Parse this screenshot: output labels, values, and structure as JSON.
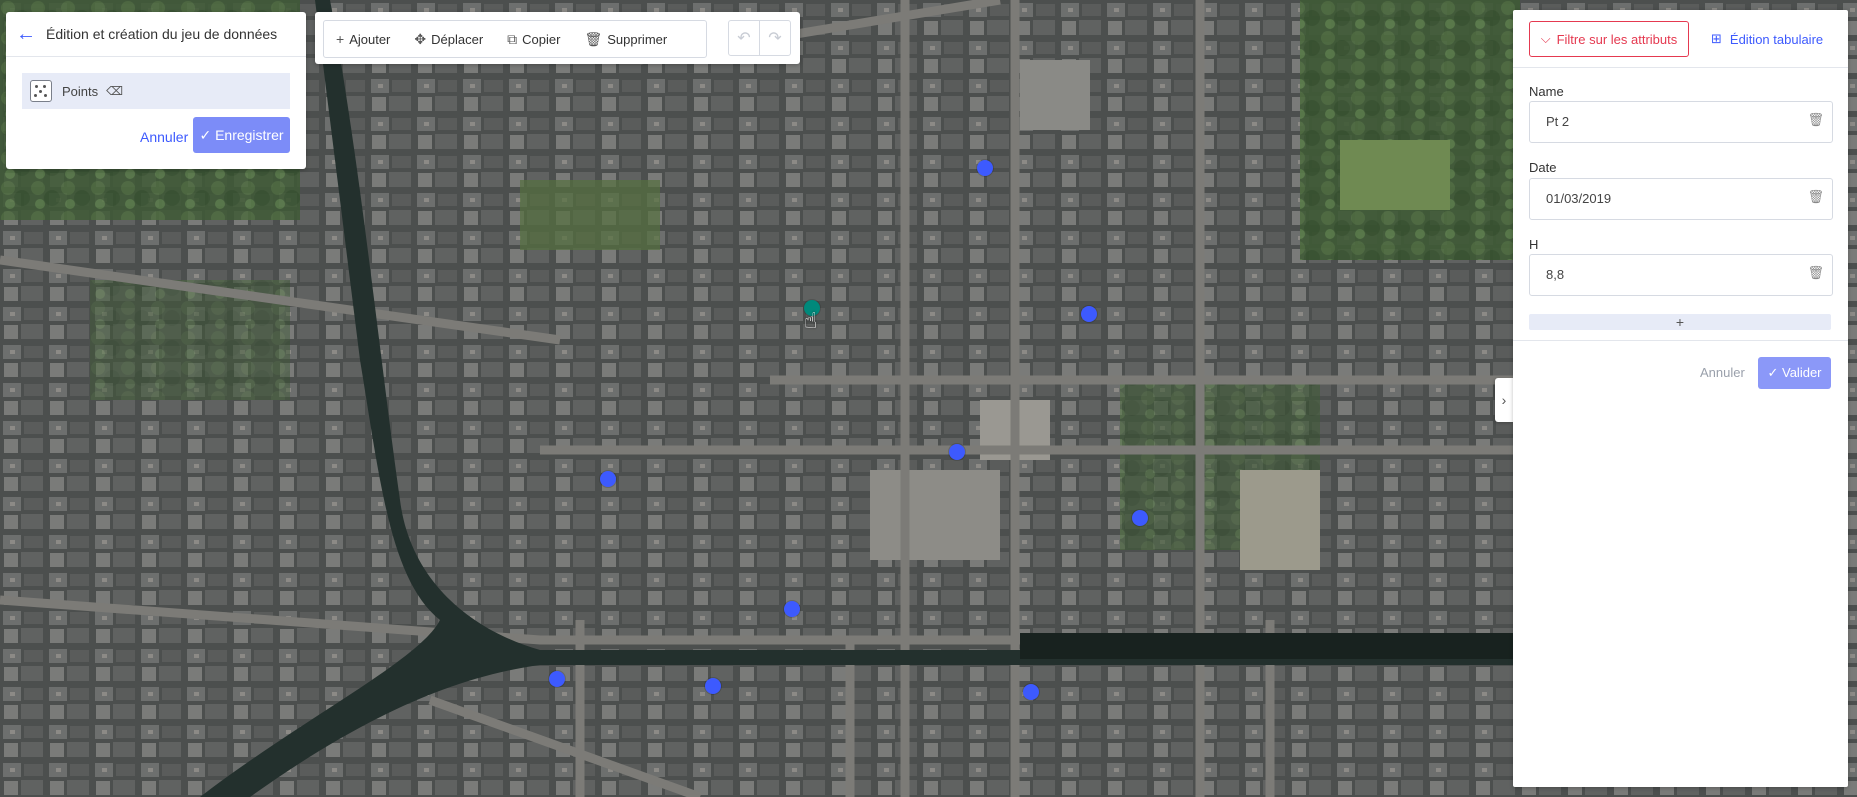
{
  "dataset_panel": {
    "title": "Édition et création du jeu de données",
    "layer_name": "Points",
    "cancel_label": "Annuler",
    "save_label": "Enregistrer"
  },
  "toolbar": {
    "add_label": "Ajouter",
    "move_label": "Déplacer",
    "copy_label": "Copier",
    "delete_label": "Supprimer"
  },
  "attribute_panel": {
    "filter_label": "Filtre sur les attributs",
    "tabular_label": "Édition tabulaire",
    "fields": [
      {
        "label": "Name",
        "value": "Pt 2"
      },
      {
        "label": "Date",
        "value": "01/03/2019"
      },
      {
        "label": "H",
        "value": "8,8"
      }
    ],
    "add_field_label": "+",
    "cancel_label": "Annuler",
    "validate_label": "Valider"
  },
  "colors": {
    "accent": "#3d5afe",
    "point": "#3d5afe",
    "selected_point": "#00897b",
    "filter_red": "#e53950"
  }
}
